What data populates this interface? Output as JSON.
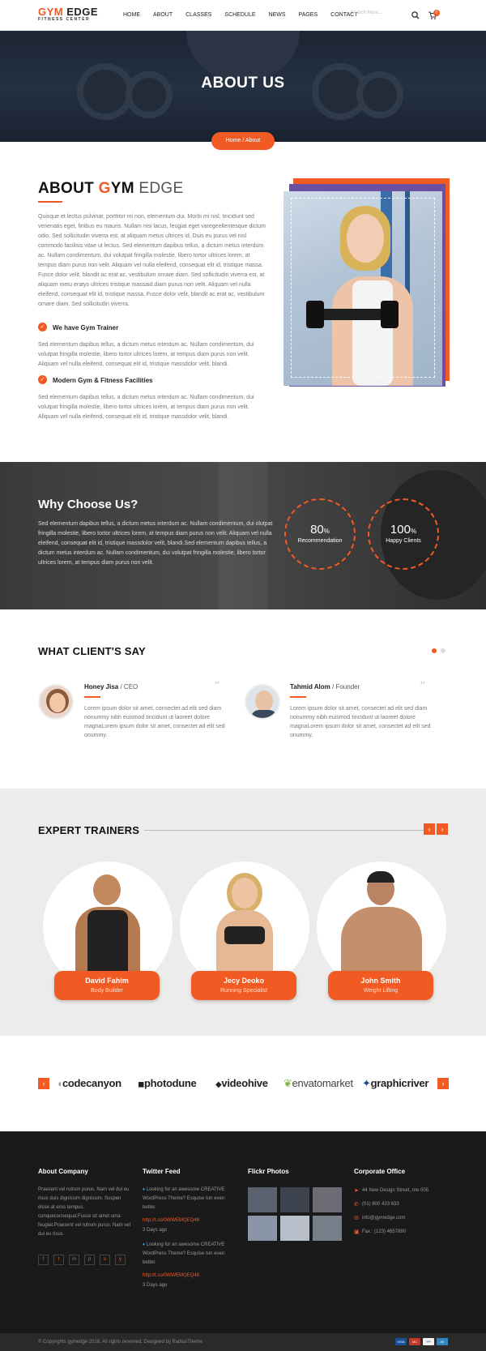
{
  "header": {
    "logo": {
      "part1": "GYM",
      "part2": " EDGE",
      "tagline": "FITNESS CENTER"
    },
    "nav": [
      "HOME",
      "ABOUT",
      "CLASSES",
      "SCHEDULE",
      "NEWS",
      "PAGES",
      "CONTACT"
    ],
    "search_placeholder": "Search Here...",
    "cart_count": "0"
  },
  "hero": {
    "title": "ABOUT US",
    "breadcrumb_home": "Home",
    "breadcrumb_sep": "/",
    "breadcrumb_current": "About"
  },
  "about": {
    "title_part1": "ABOUT ",
    "title_g": "G",
    "title_ym": "YM",
    "title_edge": " EDGE",
    "intro": "Quisque et lectus pulvinar, porttitor mi non, elementum dui. Morbi mi nisl, tincidunt sed venenatis eget, finibus eu mauris. Nullam nisi lacus, feugiat eget varegeellentesque dictum odio. Sed sollicitudin viverra est, at aliquam metus ultrices id. Duis eu purus vel nisl commodo facilisis vitae ut lectus. Sed elementum dapibus tellus, a dictum metus interdum ac. Nullam condimentum, dui volutpat fringilla molestie, libero tortor ultrices lorem, at tempus diam purus non velit. Aliquam vel nulla eleifend, consequat elit id, tristique massa. Fusce dolor velit, blandit ac erat ac, vestibulum ornare diam. Sed sollicitudin viverra est, at aliquam metu eratys ultrices tristique massaid.diam purus non velit. Aliquam vel nulla eleifend, consequat elit id, tristique massa. Fusce dolor velit, blandit ac erat ac, vestibulum ornare diam. Sed sollicitudin viverra.",
    "feature1_title": "We have Gym Trainer",
    "feature1_text": "Sed elementum dapibus tellus, a dictum metus interdum ac. Nullam condimentum, dui volutpat fringilla molestie, libero tortor ultrices lorem, at tempus diam purus non velit. Aliquam vel nulla eleifend, consequat elit id, tristique massdolor velit, blandi.",
    "feature2_title": "Modern Gym & Fitness Facilities",
    "feature2_text": "Sed elementum dapibus tellus, a dictum metus interdum ac. Nullam condimentum, dui volutpat fringilla molestie, libero tortor ultrices lorem, at tempus diam purus non velit. Aliquam vel nulla eleifend, consequat elit id, tristique massdolor velit, blandi."
  },
  "why": {
    "title": "Why Choose Us?",
    "text": "Sed elementum dapibus tellus, a dictum metus interdum ac. Nullam condimentum, dui olutpat fringilla molestie, libero tortor ultrices lorem, at tempus diam purus non velit. Aliquam vel nulla eleifend, consequat elit id, tristique massdolor velit, blandi.Sed elementum dapibus tellus, a dictum metus interdum ac. Nullam condimentum, dui volutpat fringilla molestie, libero tortor ultrices lorem, at tempus diam purus non velit.",
    "stats": [
      {
        "value": "80",
        "unit": "%",
        "label": "Recommendation"
      },
      {
        "value": "100",
        "unit": "%",
        "label": "Happy Clients"
      }
    ]
  },
  "testimonials": {
    "title": "WHAT CLIENT'S SAY",
    "items": [
      {
        "name": "Honey Jisa",
        "sep": " / ",
        "role": "CEO",
        "text": "Lorem ipsum dolor sit amet, consectet ad elit sed diam nonummy nibh euismod tincidunt ut laoreet dolore magnaLorem ipsum dolor sit amet, consectet ad elit sed onummy."
      },
      {
        "name": "Tahmid Alom",
        "sep": " / ",
        "role": "Founder",
        "text": "Lorem ipsum dolor sit amet, consectet ad elit sed diam nonummy nibh euismod tincidunt ut laoreet dolore magnaLorem ipsum dolor sit amet, consectet ad elit sed onummy."
      }
    ]
  },
  "trainers": {
    "title": "EXPERT TRAINERS",
    "items": [
      {
        "name": "David Fahim",
        "role": "Body Builder"
      },
      {
        "name": "Jecy Deoko",
        "role": "Running Specialist"
      },
      {
        "name": "John Smith",
        "role": "Weight Lifting"
      }
    ]
  },
  "brands": [
    "codecanyon",
    "photodune",
    "videohive",
    "envatomarket",
    "graphicriver"
  ],
  "footer": {
    "about_title": "About Company",
    "about_text": "Praesent vel rutrum purus. Nam vel dui eu risus duis dignissim dignissim. Suspen disse at eros tempus. conqueconsequat.Fusce sit amet urna feugiat.Praesent vel rutrum purus. Nam vel dui eu risus.",
    "social": [
      "f",
      "t",
      "in",
      "p",
      "s",
      "y"
    ],
    "twitter_title": "Twitter Feed",
    "tweets": [
      {
        "text": "Looking for an awesome CREATIVE WordPress Theme? Esquise run even better.",
        "link": "http://t.co/0WWEMQEQ48",
        "time": "3 Days ago"
      },
      {
        "text": "Looking for an awesome CREATIVE WordPress Theme? Esquise run even better.",
        "link": "http://t.co/0WWEMQEQ48",
        "time": "3 Days ago"
      }
    ],
    "flickr_title": "Flickr Photos",
    "office_title": "Corporate Office",
    "address": "44 New Design Street, rne 005",
    "phone": "(01) 800 433 633",
    "email": "info@gymedge.com",
    "fax": "Fax : (123) 4657890",
    "copyright": "© Copyrights gymedge 2016. All rights reserved. Designed by RadiusTheme",
    "payments": [
      "VISA",
      "MC",
      "PP",
      "AE"
    ]
  },
  "colors": {
    "accent": "#f15a22",
    "dark": "#1a1a1a"
  }
}
